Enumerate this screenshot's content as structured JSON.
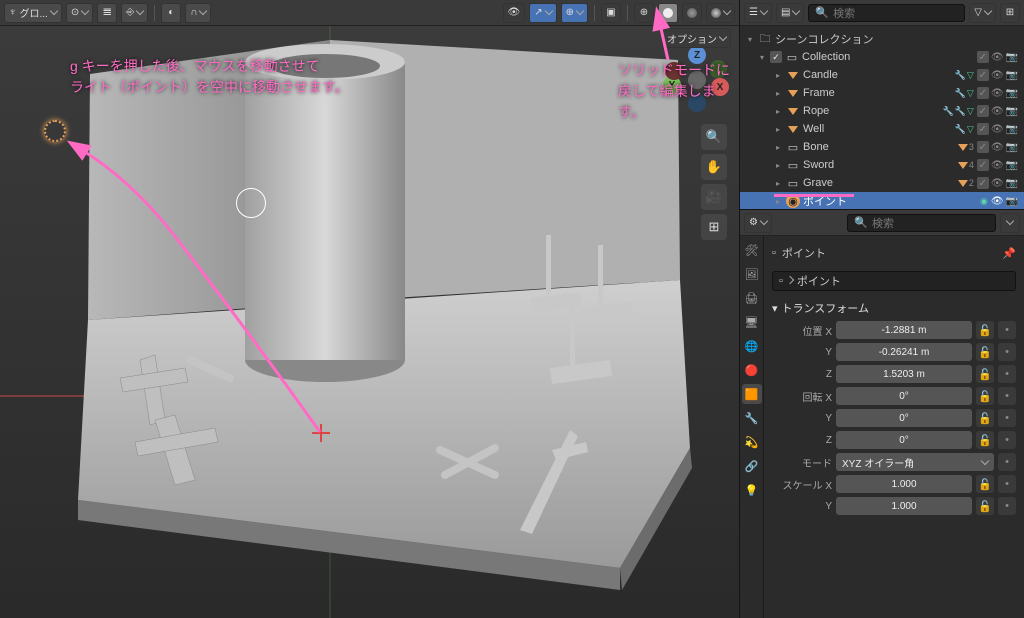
{
  "header": {
    "orientation_label": "グロ...",
    "options_label": "オプション"
  },
  "gizmo": {
    "x": "X",
    "y": "Y",
    "z": "Z"
  },
  "annotations": {
    "left_line1": "g キーを押した後、マウスを移動させて",
    "left_line2": "ライト（ポイント）を空中に移動させます。",
    "right_line1": "ソリッドモードに",
    "right_line2": "戻して編集します。"
  },
  "outliner": {
    "search_placeholder": "検索",
    "root": "シーンコレクション",
    "collection": "Collection",
    "items": [
      {
        "label": "Candle",
        "kind": "mesh",
        "mods": true
      },
      {
        "label": "Frame",
        "kind": "mesh",
        "mods": true
      },
      {
        "label": "Rope",
        "kind": "mesh",
        "mods": true
      },
      {
        "label": "Well",
        "kind": "mesh",
        "mods": true
      },
      {
        "label": "Bone",
        "kind": "obj",
        "count": "3"
      },
      {
        "label": "Sword",
        "kind": "obj",
        "count": "4"
      },
      {
        "label": "Grave",
        "kind": "obj",
        "count": "2"
      },
      {
        "label": "ポイント",
        "kind": "light",
        "selected": true
      }
    ]
  },
  "properties": {
    "search_placeholder": "検索",
    "breadcrumb1": "ポイント",
    "breadcrumb2": "ポイント",
    "section_transform": "トランスフォーム",
    "loc_label": "位置 X",
    "loc_x": "-1.2881 m",
    "loc_y_label": "Y",
    "loc_y": "-0.26241 m",
    "loc_z_label": "Z",
    "loc_z": "1.5203 m",
    "rot_label": "回転 X",
    "rot_x": "0°",
    "rot_y_label": "Y",
    "rot_y": "0°",
    "rot_z_label": "Z",
    "rot_z": "0°",
    "mode_label": "モード",
    "mode_value": "XYZ オイラー角",
    "scale_label": "スケール X",
    "scale_x": "1.000",
    "scale_y_label": "Y",
    "scale_y": "1.000"
  }
}
